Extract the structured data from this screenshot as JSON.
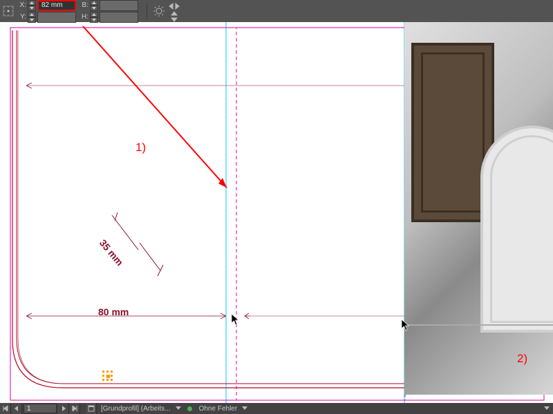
{
  "toolbar": {
    "x_label": "X:",
    "y_label": "Y:",
    "b_label": "B:",
    "h_label": "H:",
    "x_value": "82 mm",
    "y_value": "",
    "b_value": "",
    "h_value": ""
  },
  "annotations": {
    "callout1": "1)",
    "callout2": "2)"
  },
  "measurements": {
    "diag": "35 mm",
    "horiz": "80 mm"
  },
  "statusbar": {
    "page": "1",
    "doc": "[Grundprofil] (Arbeits...",
    "status": "Ohne Fehler"
  }
}
